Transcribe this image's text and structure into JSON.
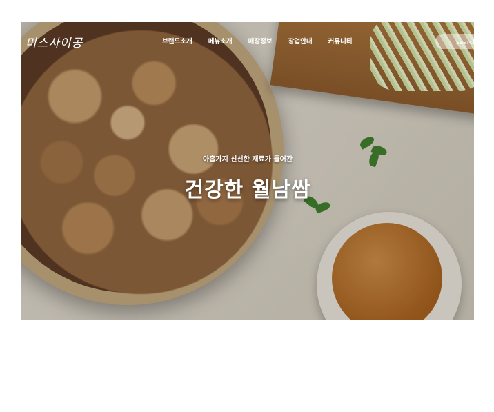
{
  "header": {
    "logo": "미스사이공",
    "menu": [
      "브랜드소개",
      "메뉴소개",
      "매장정보",
      "창업안내",
      "커뮤니티"
    ],
    "search_placeholder": "search"
  },
  "hero": {
    "subtitle": "아홉가지 신선한 재료가 들어간",
    "title": "건강한 월남쌈"
  }
}
